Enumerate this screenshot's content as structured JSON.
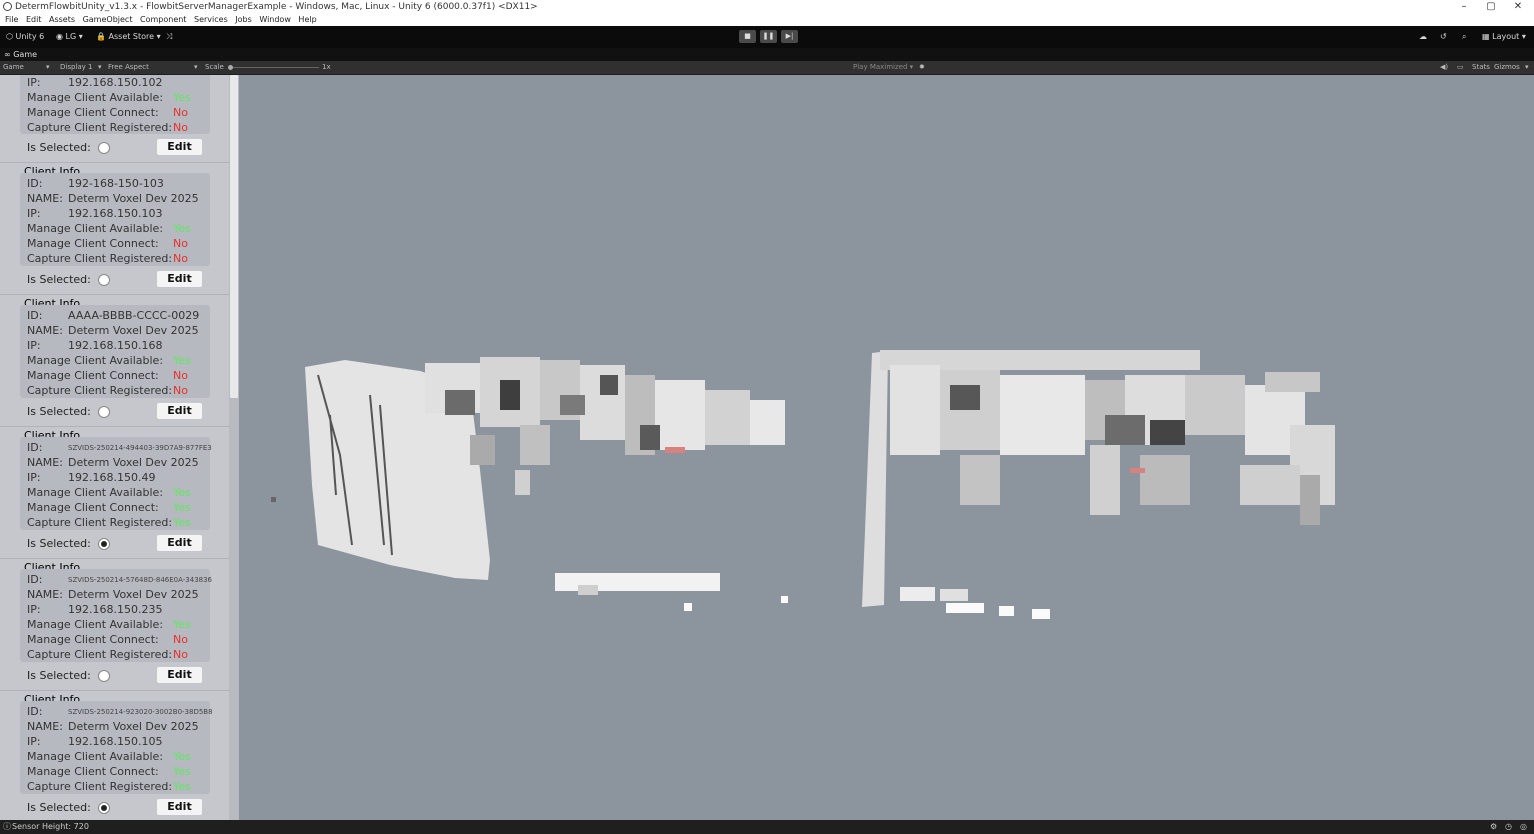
{
  "window": {
    "title": "DetermFlowbitUnity_v1.3.x - FlowbitServerManagerExample - Windows, Mac, Linux - Unity 6 (6000.0.37f1) <DX11>",
    "minimize": "–",
    "maximize": "▢",
    "close": "✕"
  },
  "menu": [
    "File",
    "Edit",
    "Assets",
    "GameObject",
    "Component",
    "Services",
    "Jobs",
    "Window",
    "Help"
  ],
  "toolbar": {
    "unity_label": "Unity 6",
    "account_label": "LG",
    "asset_store_label": "Asset Store",
    "layout_label": "Layout",
    "stop_glyph": "■",
    "pause_glyph": "❚❚",
    "step_glyph": "▶|"
  },
  "tab": {
    "label": "Game"
  },
  "gamebar": {
    "mode": "Game",
    "display": "Display 1",
    "aspect": "Free Aspect",
    "scale_label": "Scale",
    "scale_value": "1x",
    "play_mode": "Play Maximized",
    "stats": "Stats",
    "gizmos": "Gizmos"
  },
  "labels": {
    "client_info": "Client Info",
    "id": "ID:",
    "name": "NAME:",
    "ip": "IP:",
    "manage_available": "Manage Client Available:",
    "manage_connect": "Manage Client Connect:",
    "capture_registered": "Capture Client Registered:",
    "is_selected": "Is Selected:",
    "edit": "Edit"
  },
  "clients": [
    {
      "id": "",
      "name": "",
      "ip": "192.168.150.102",
      "manage_available": "Yes",
      "manage_connect": "No",
      "capture_registered": "No",
      "selected": false
    },
    {
      "id": "192-168-150-103",
      "name": "Determ Voxel Dev 2025",
      "ip": "192.168.150.103",
      "manage_available": "Yes",
      "manage_connect": "No",
      "capture_registered": "No",
      "selected": false
    },
    {
      "id": "AAAA-BBBB-CCCC-0029",
      "name": "Determ Voxel Dev 2025",
      "ip": "192.168.150.168",
      "manage_available": "Yes",
      "manage_connect": "No",
      "capture_registered": "No",
      "selected": false
    },
    {
      "id": "SZVIDS-250214-494403-39D7A9-877FE3",
      "name": "Determ Voxel Dev 2025",
      "ip": "192.168.150.49",
      "manage_available": "Yes",
      "manage_connect": "Yes",
      "capture_registered": "Yes",
      "selected": true
    },
    {
      "id": "SZVIDS-250214-57648D-846E0A-343836",
      "name": "Determ Voxel Dev 2025",
      "ip": "192.168.150.235",
      "manage_available": "Yes",
      "manage_connect": "No",
      "capture_registered": "No",
      "selected": false
    },
    {
      "id": "SZVIDS-250214-923020-3002B0-38D5B8",
      "name": "Determ Voxel Dev 2025",
      "ip": "192.168.150.105",
      "manage_available": "Yes",
      "manage_connect": "Yes",
      "capture_registered": "Yes",
      "selected": true
    }
  ],
  "status": {
    "text": "Sensor Height: 720"
  },
  "colors": {
    "yes": "#5ee85e",
    "no": "#e5312c",
    "viewport_bg": "#8c949d",
    "panel_bg": "#c5c7cc"
  },
  "icons": [
    "unity-icon",
    "account-icon",
    "asset-store-icon",
    "version-control-icon",
    "cloud-icon",
    "history-icon",
    "search-icon",
    "layout-icon",
    "game-tab-icon",
    "gamebar-settings-icon",
    "mute-icon",
    "stats-icon"
  ]
}
